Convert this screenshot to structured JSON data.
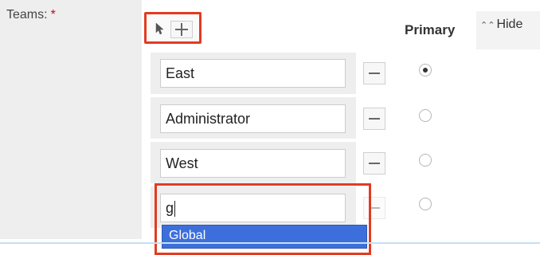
{
  "form": {
    "label": "Teams:",
    "required_mark": "*"
  },
  "columns": {
    "primary": "Primary",
    "hide": "Hide"
  },
  "teams": [
    {
      "name": "East",
      "primary": true
    },
    {
      "name": "Administrator",
      "primary": false
    },
    {
      "name": "West",
      "primary": false
    },
    {
      "name": "g",
      "primary": false
    }
  ],
  "autocomplete": {
    "suggestion": "Global"
  },
  "icons": {
    "select": "cursor-arrow-icon",
    "add": "plus-icon",
    "remove": "minus-icon",
    "hide": "double-chevron-up-icon"
  },
  "colors": {
    "highlight": "#e23b22",
    "selection": "#3d6fdc"
  }
}
